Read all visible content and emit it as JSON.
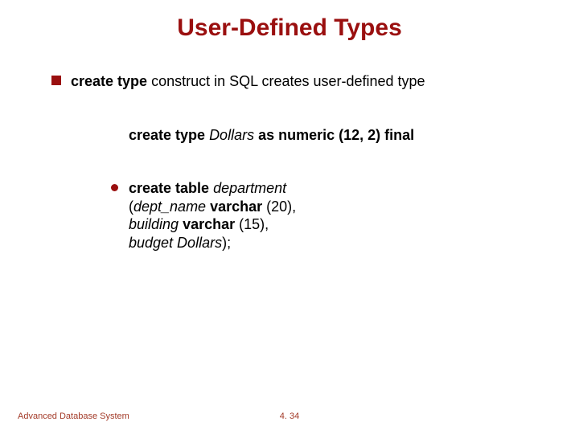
{
  "title": "User-Defined Types",
  "bullet1": {
    "pre": "create type",
    "post": " construct in SQL creates user-defined type"
  },
  "code1": {
    "p1": "create type ",
    "p2": "Dollars ",
    "p3": "as numeric (12, 2) final"
  },
  "bullet2": {
    "l1a": "create table ",
    "l1b": "department",
    "l2a": "(",
    "l2b": "dept_name ",
    "l2c": "varchar ",
    "l2d": "(20),",
    "l3a": " building ",
    "l3b": "varchar ",
    "l3c": "(15),",
    "l4a": " budget Dollars",
    "l4b": ");"
  },
  "footer": {
    "left": "Advanced Database System",
    "page": "4. 34"
  }
}
